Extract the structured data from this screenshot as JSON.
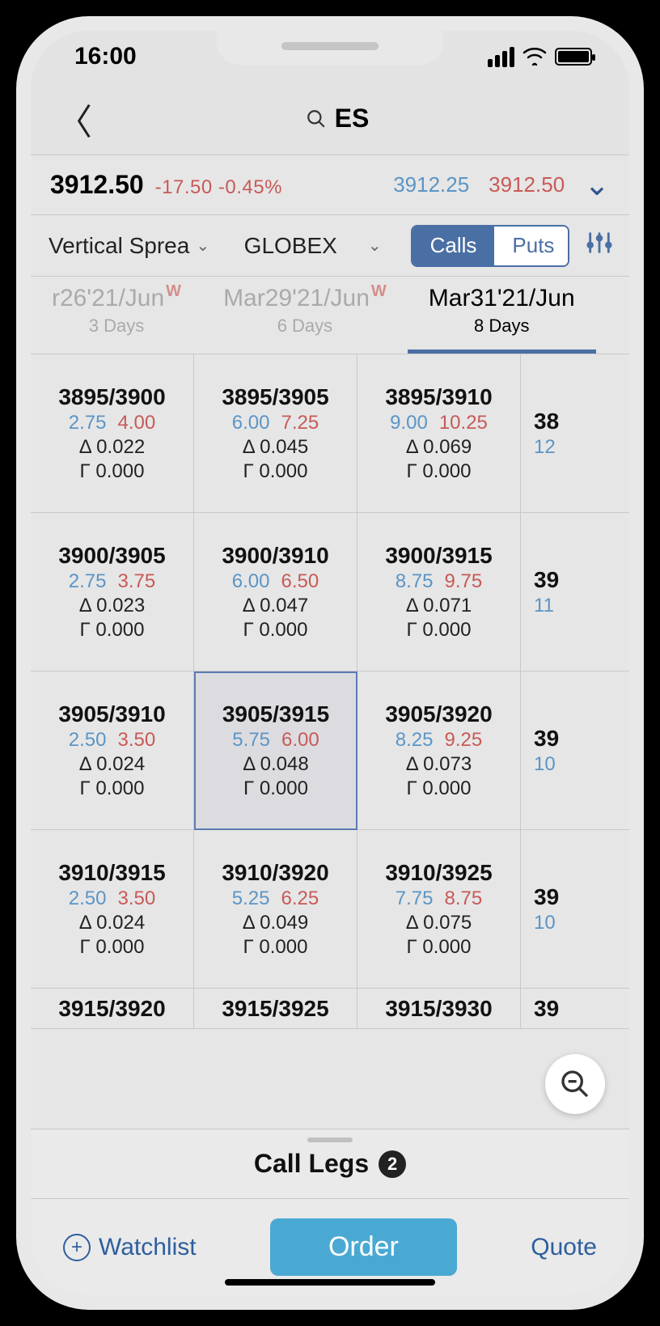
{
  "status": {
    "time": "16:00"
  },
  "header": {
    "symbol": "ES"
  },
  "quote": {
    "last": "3912.50",
    "change": "-17.50 -0.45%",
    "bid": "3912.25",
    "ask": "3912.50"
  },
  "strategy": {
    "type": "Vertical Spread",
    "type_display": "Vertical Sprea",
    "exchange": "GLOBEX",
    "calls_label": "Calls",
    "puts_label": "Puts"
  },
  "tabs": [
    {
      "label": "r26'21/Jun",
      "w": "W",
      "sub": "3 Days",
      "active": false
    },
    {
      "label": "Mar29'21/Jun",
      "w": "W",
      "sub": "6 Days",
      "active": false
    },
    {
      "label": "Mar31'21/Jun",
      "w": "",
      "sub": "8 Days",
      "active": true
    }
  ],
  "grid": {
    "rows": [
      [
        {
          "strikes": "3895/3900",
          "bid": "2.75",
          "ask": "4.00",
          "delta": "Δ 0.022",
          "gamma": "Γ 0.000"
        },
        {
          "strikes": "3895/3905",
          "bid": "6.00",
          "ask": "7.25",
          "delta": "Δ 0.045",
          "gamma": "Γ 0.000"
        },
        {
          "strikes": "3895/3910",
          "bid": "9.00",
          "ask": "10.25",
          "delta": "Δ 0.069",
          "gamma": "Γ 0.000"
        },
        {
          "strikes": "38",
          "bid": "12",
          "ask": "",
          "delta": "",
          "gamma": "",
          "partial": true
        }
      ],
      [
        {
          "strikes": "3900/3905",
          "bid": "2.75",
          "ask": "3.75",
          "delta": "Δ 0.023",
          "gamma": "Γ 0.000"
        },
        {
          "strikes": "3900/3910",
          "bid": "6.00",
          "ask": "6.50",
          "delta": "Δ 0.047",
          "gamma": "Γ 0.000"
        },
        {
          "strikes": "3900/3915",
          "bid": "8.75",
          "ask": "9.75",
          "delta": "Δ 0.071",
          "gamma": "Γ 0.000"
        },
        {
          "strikes": "39",
          "bid": "11",
          "ask": "",
          "delta": "",
          "gamma": "",
          "partial": true
        }
      ],
      [
        {
          "strikes": "3905/3910",
          "bid": "2.50",
          "ask": "3.50",
          "delta": "Δ 0.024",
          "gamma": "Γ 0.000"
        },
        {
          "strikes": "3905/3915",
          "bid": "5.75",
          "ask": "6.00",
          "delta": "Δ 0.048",
          "gamma": "Γ 0.000",
          "selected": true
        },
        {
          "strikes": "3905/3920",
          "bid": "8.25",
          "ask": "9.25",
          "delta": "Δ 0.073",
          "gamma": "Γ 0.000"
        },
        {
          "strikes": "39",
          "bid": "10",
          "ask": "",
          "delta": "",
          "gamma": "",
          "partial": true
        }
      ],
      [
        {
          "strikes": "3910/3915",
          "bid": "2.50",
          "ask": "3.50",
          "delta": "Δ 0.024",
          "gamma": "Γ 0.000"
        },
        {
          "strikes": "3910/3920",
          "bid": "5.25",
          "ask": "6.25",
          "delta": "Δ 0.049",
          "gamma": "Γ 0.000"
        },
        {
          "strikes": "3910/3925",
          "bid": "7.75",
          "ask": "8.75",
          "delta": "Δ 0.075",
          "gamma": "Γ 0.000"
        },
        {
          "strikes": "39",
          "bid": "10",
          "ask": "",
          "delta": "",
          "gamma": "",
          "partial": true
        }
      ],
      [
        {
          "strikes": "3915/3920",
          "partial_row": true
        },
        {
          "strikes": "3915/3925",
          "partial_row": true
        },
        {
          "strikes": "3915/3930",
          "partial_row": true
        },
        {
          "strikes": "39",
          "partial": true,
          "partial_row": true
        }
      ]
    ]
  },
  "legs": {
    "label": "Call Legs",
    "count": "2"
  },
  "actions": {
    "watchlist": "Watchlist",
    "order": "Order",
    "quote": "Quote"
  }
}
